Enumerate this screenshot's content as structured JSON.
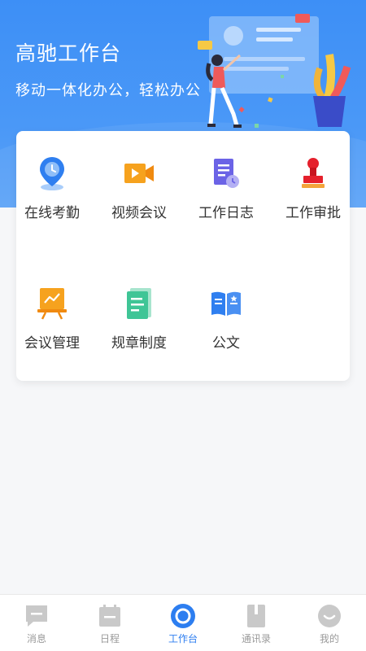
{
  "header": {
    "title": "高驰工作台",
    "subtitle": "移动一体化办公，轻松办公"
  },
  "apps": [
    {
      "label": "在线考勤",
      "icon": "location-pin-icon"
    },
    {
      "label": "视频会议",
      "icon": "video-camera-icon"
    },
    {
      "label": "工作日志",
      "icon": "document-clock-icon"
    },
    {
      "label": "工作审批",
      "icon": "stamp-icon"
    },
    {
      "label": "会议管理",
      "icon": "presentation-board-icon"
    },
    {
      "label": "规章制度",
      "icon": "document-list-icon"
    },
    {
      "label": "公文",
      "icon": "open-book-icon"
    }
  ],
  "tabs": [
    {
      "label": "消息",
      "icon": "message-icon",
      "active": false
    },
    {
      "label": "日程",
      "icon": "calendar-icon",
      "active": false
    },
    {
      "label": "工作台",
      "icon": "workbench-icon",
      "active": true
    },
    {
      "label": "通讯录",
      "icon": "contacts-icon",
      "active": false
    },
    {
      "label": "我的",
      "icon": "profile-icon",
      "active": false
    }
  ],
  "colors": {
    "header_blue": "#3d8ff6",
    "active_tab": "#2d7ef0",
    "inactive_tab": "#9a9a9a"
  }
}
